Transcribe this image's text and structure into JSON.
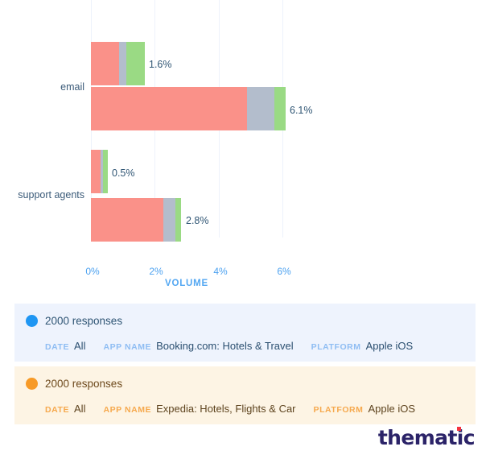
{
  "chart_data": {
    "type": "bar",
    "orientation": "horizontal",
    "stacked": true,
    "title": "",
    "xlabel": "VOLUME",
    "ylabel": "",
    "xlim": [
      0,
      6.6
    ],
    "xticks": [
      "0%",
      "2%",
      "4%",
      "6%"
    ],
    "xtick_values": [
      0,
      2,
      4,
      6
    ],
    "grid": true,
    "legend_position": "below-chart",
    "categories": [
      "email",
      "support agents"
    ],
    "series": [
      {
        "name": "Booking.com: Hotels & Travel",
        "color": "#1f96f3",
        "values": [
          1.6,
          0.5
        ],
        "labels": [
          "1.6%",
          "0.5%"
        ],
        "segments": [
          {
            "category": "email",
            "negative": 0.88,
            "neutral": 0.23,
            "positive": 0.58
          },
          {
            "category": "support agents",
            "negative": 0.3,
            "neutral": 0.07,
            "positive": 0.15
          }
        ]
      },
      {
        "name": "Expedia: Hotels, Flights & Car",
        "color": "#f79a27",
        "values": [
          6.1,
          2.8
        ],
        "labels": [
          "6.1%",
          "2.8%"
        ],
        "segments": [
          {
            "category": "email",
            "negative": 4.89,
            "neutral": 0.86,
            "positive": 0.35
          },
          {
            "category": "support agents",
            "negative": 2.27,
            "neutral": 0.38,
            "positive": 0.18
          }
        ]
      }
    ],
    "segment_colors": {
      "negative": "#fa9189",
      "neutral": "#b3bdcc",
      "positive": "#9ada84"
    }
  },
  "chart": {
    "axis_title": "VOLUME",
    "xticks": [
      "0%",
      "2%",
      "4%",
      "6%"
    ],
    "ylabels": [
      "email",
      "support agents"
    ],
    "bars": [
      {
        "value_label": "1.6%",
        "neg": 0.88,
        "neu": 0.23,
        "pos": 0.58
      },
      {
        "value_label": "6.1%",
        "neg": 4.89,
        "neu": 0.86,
        "pos": 0.35
      },
      {
        "value_label": "0.5%",
        "neg": 0.3,
        "neu": 0.07,
        "pos": 0.15
      },
      {
        "value_label": "2.8%",
        "neg": 2.27,
        "neu": 0.38,
        "pos": 0.18
      }
    ]
  },
  "cards": [
    {
      "dot_color": "#1f96f3",
      "responses": "2000 responses",
      "filters": [
        {
          "key": "DATE",
          "value": "All"
        },
        {
          "key": "APP NAME",
          "value": "Booking.com: Hotels & Travel"
        },
        {
          "key": "PLATFORM",
          "value": "Apple iOS"
        }
      ]
    },
    {
      "dot_color": "#f79a27",
      "responses": "2000 responses",
      "filters": [
        {
          "key": "DATE",
          "value": "All"
        },
        {
          "key": "APP NAME",
          "value": "Expedia: Hotels, Flights & Car"
        },
        {
          "key": "PLATFORM",
          "value": "Apple iOS"
        }
      ]
    }
  ],
  "branding": {
    "logo_text": "thematic"
  }
}
